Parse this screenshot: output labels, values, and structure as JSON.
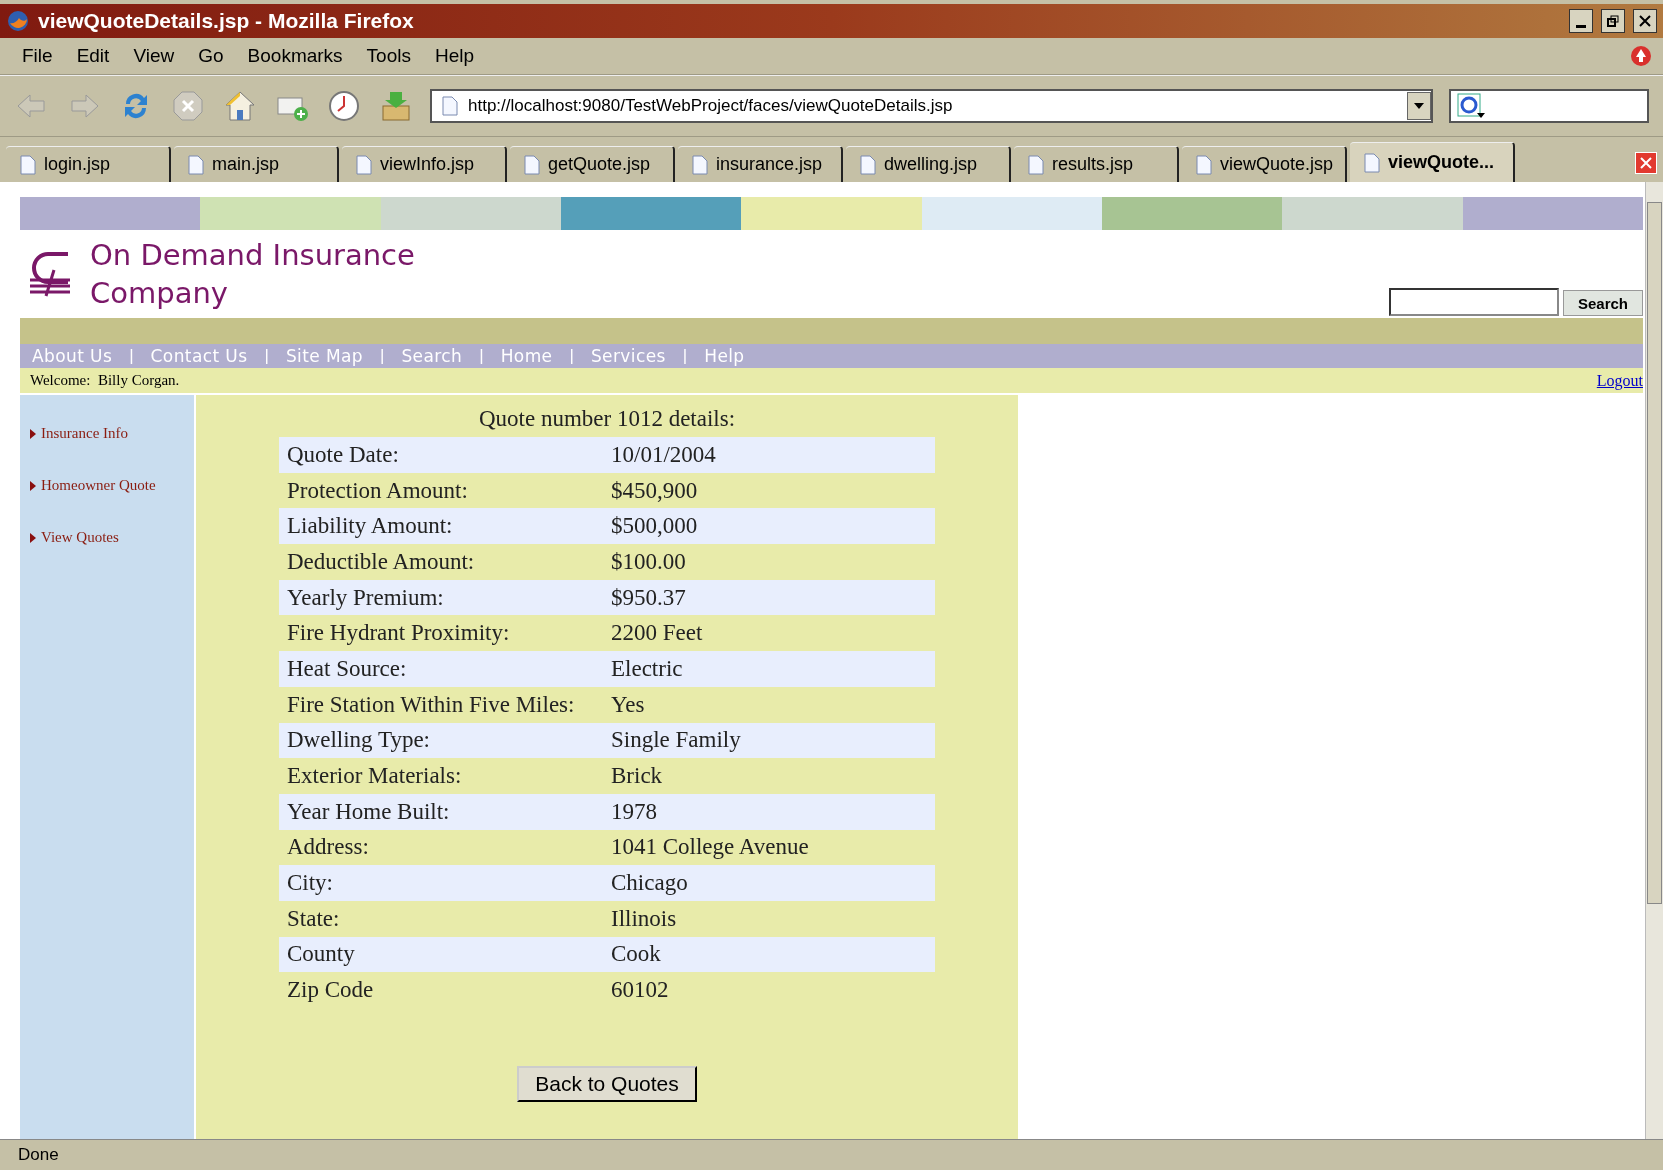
{
  "window": {
    "title": "viewQuoteDetails.jsp - Mozilla Firefox"
  },
  "menu": [
    "File",
    "Edit",
    "View",
    "Go",
    "Bookmarks",
    "Tools",
    "Help"
  ],
  "address": {
    "value": "http://localhost:9080/TestWebProject/faces/viewQuoteDetails.jsp"
  },
  "tabs": [
    {
      "label": "login.jsp",
      "selected": false
    },
    {
      "label": "main.jsp",
      "selected": false
    },
    {
      "label": "viewInfo.jsp",
      "selected": false
    },
    {
      "label": "getQuote.jsp",
      "selected": false
    },
    {
      "label": "insurance.jsp",
      "selected": false
    },
    {
      "label": "dwelling.jsp",
      "selected": false
    },
    {
      "label": "results.jsp",
      "selected": false
    },
    {
      "label": "viewQuote.jsp",
      "selected": false
    },
    {
      "label": "viewQuote...",
      "selected": true
    }
  ],
  "color_strip": [
    {
      "color": "#b0aece"
    },
    {
      "color": "#cfe2b3"
    },
    {
      "color": "#cdd8ce"
    },
    {
      "color": "#559fb9"
    },
    {
      "color": "#e8ebaa"
    },
    {
      "color": "#deebf4"
    },
    {
      "color": "#a7c493"
    },
    {
      "color": "#cdd8ce"
    },
    {
      "color": "#b0aece"
    }
  ],
  "header": {
    "company": "On Demand Insurance Company",
    "search_button": "Search"
  },
  "nav": [
    {
      "label": "About Us"
    },
    {
      "separator": "|",
      "label": "Contact Us"
    },
    {
      "separator": "|",
      "label": "Site Map"
    },
    {
      "separator": "|",
      "label": "Search"
    },
    {
      "separator": "|",
      "label": "Home"
    },
    {
      "separator": "|",
      "label": "Services"
    },
    {
      "separator": "|",
      "label": "Help"
    }
  ],
  "welcome": "Welcome:  Billy Corgan.",
  "logout": "Logout",
  "sidebar": [
    "Insurance Info",
    "Homeowner Quote",
    "View Quotes"
  ],
  "heading": "Quote number 1012 details:",
  "rows": [
    {
      "label": "Quote Date:",
      "value": "10/01/2004"
    },
    {
      "label": "Protection Amount:",
      "value": "$450,900"
    },
    {
      "label": "Liability Amount:",
      "value": "$500,000"
    },
    {
      "label": "Deductible Amount:",
      "value": "$100.00"
    },
    {
      "label": "Yearly Premium:",
      "value": "$950.37"
    },
    {
      "label": "Fire Hydrant Proximity:",
      "value": "2200 Feet"
    },
    {
      "label": "Heat Source:",
      "value": "Electric"
    },
    {
      "label": "Fire Station Within Five Miles:",
      "value": "Yes"
    },
    {
      "label": "Dwelling Type:",
      "value": "Single Family"
    },
    {
      "label": "Exterior Materials:",
      "value": "Brick"
    },
    {
      "label": "Year Home Built:",
      "value": "1978"
    },
    {
      "label": "Address:",
      "value": "1041 College Avenue"
    },
    {
      "label": "City:",
      "value": "Chicago"
    },
    {
      "label": "State:",
      "value": "Illinois"
    },
    {
      "label": "County",
      "value": "Cook"
    },
    {
      "label": "Zip Code",
      "value": "60102"
    }
  ],
  "back_button": "Back to Quotes",
  "status_bar": "Done"
}
